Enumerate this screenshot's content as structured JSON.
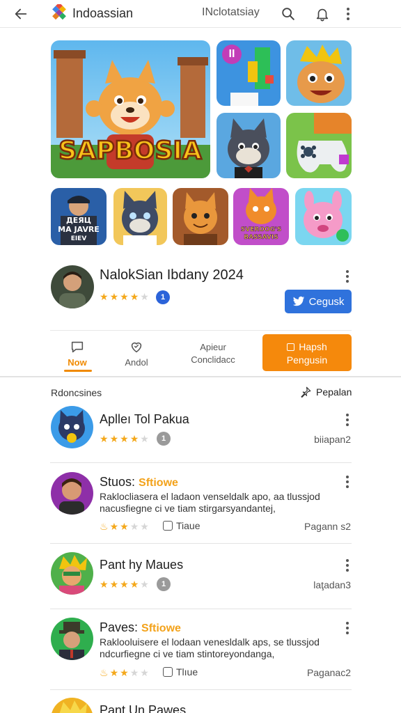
{
  "topbar": {
    "brand": "Indoassian",
    "right_text": "INclotatsiay",
    "icons": [
      "back-arrow-icon",
      "search-icon",
      "notification-icon",
      "more-vertical-icon"
    ]
  },
  "banner": {
    "main_title": "SAPBOSIA",
    "tile_top_right_badge": "II",
    "small_tiles": [
      {
        "text_line1": "ДЕЯЦ",
        "text_line2": "MA JAVRE",
        "text_line3": "EIEV"
      },
      {
        "text_line1": ""
      },
      {
        "text_line1": ""
      },
      {
        "text_line1": "SVEROOG'S",
        "text_line2": "BASSAVIS"
      },
      {
        "text_line1": ""
      }
    ]
  },
  "app": {
    "title": "NalokSian Ibdany 2024",
    "rating": 4,
    "badge": "1",
    "follow_label": "Cegusk"
  },
  "tabs": {
    "items": [
      {
        "label": "Now",
        "active": true
      },
      {
        "label": "Andol",
        "active": false
      },
      {
        "label_line1": "Apieur",
        "label_line2": "Conclidacc",
        "active": false
      }
    ],
    "cta_line1": "Hapsh",
    "cta_line2": "Pengusin"
  },
  "section": {
    "label": "Rdoncsines",
    "action_label": "Pepalan"
  },
  "list": [
    {
      "title": "Aplleı Tol Pakua",
      "highlight": "",
      "rating": 4,
      "badge": "1",
      "meta": "biiapan2"
    },
    {
      "title": "Stuos: ",
      "highlight": "Sftiowe",
      "desc_line1": "Raklocliasera el ladaon venseldalk apo,  aa tlussjod",
      "desc_line2": "nacusfiegne ci ve tiam stirgarsyandantej,",
      "rating": 3,
      "tag": "Tiaue",
      "meta": "Pagann s2"
    },
    {
      "title": "Pant hy Maues",
      "highlight": "",
      "rating": 4,
      "badge": "1",
      "meta": "laţadan3"
    },
    {
      "title": "Paves: ",
      "highlight": "Sftiowe",
      "desc_line1": "Raklooluisere el lodaan venesldalk aps,  se tlussjod",
      "desc_line2": "ndcurfiegne ci ve tiam stintoreyondanga,",
      "rating": 3,
      "tag": "Tlıue",
      "meta": "Paganac2"
    },
    {
      "title": "Pant Un Pawes",
      "highlight": ""
    }
  ]
}
